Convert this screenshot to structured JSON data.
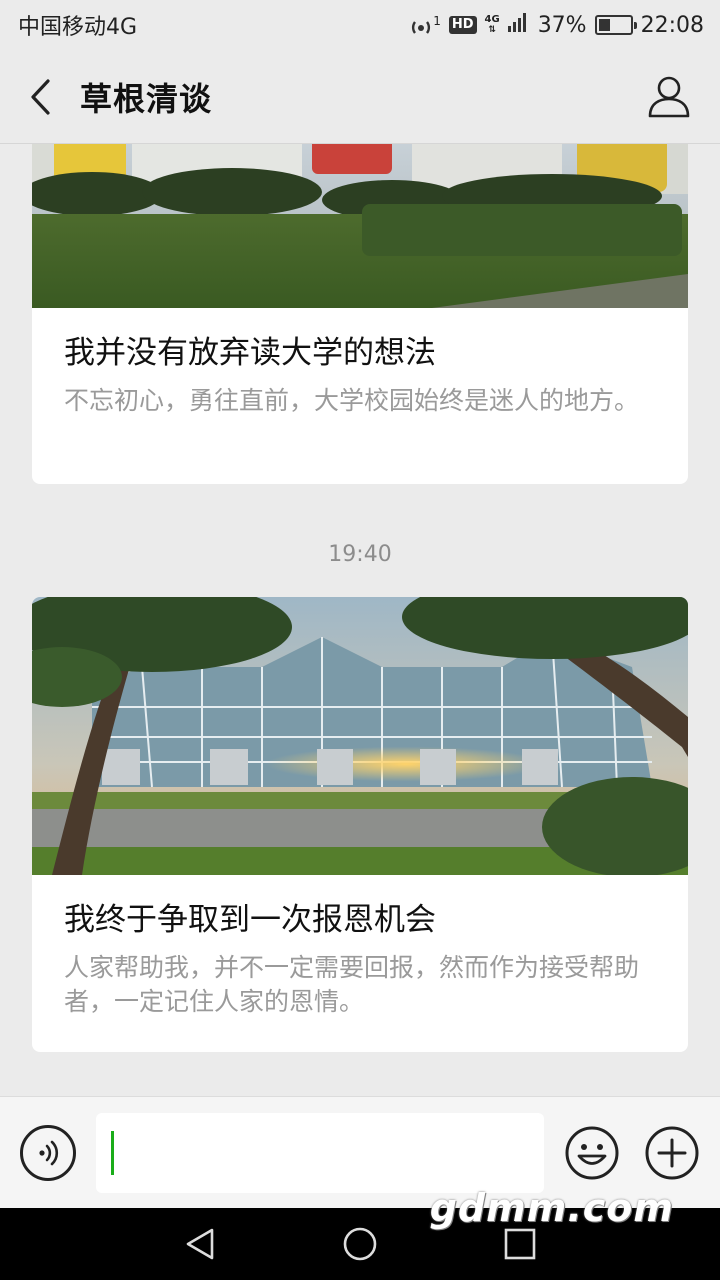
{
  "status_bar": {
    "carrier": "中国移动4G",
    "hotspot_count": "1",
    "hd": "HD",
    "net": "4G",
    "battery": "37%",
    "battery_level": 0.37,
    "time": "22:08"
  },
  "nav": {
    "title": "草根清谈"
  },
  "articles": [
    {
      "title": "我并没有放弃读大学的想法",
      "desc": "不忘初心，勇往直前，大学校园始终是迷人的地方。"
    },
    {
      "time": "19:40",
      "title": "我终于争取到一次报恩机会",
      "desc": "人家帮助我，并不一定需要回报，然而作为接受帮助者，一定记住人家的恩情。"
    }
  ],
  "input": {
    "value": ""
  },
  "watermark": "gdmm.com",
  "icons": {
    "back": "chevron-left-icon",
    "profile": "person-icon",
    "voice": "voice-icon",
    "emoji": "emoji-icon",
    "add": "plus-icon"
  },
  "colors": {
    "accent": "#1aad19",
    "background": "#ebebeb",
    "muted_text": "#9a9a9a"
  }
}
